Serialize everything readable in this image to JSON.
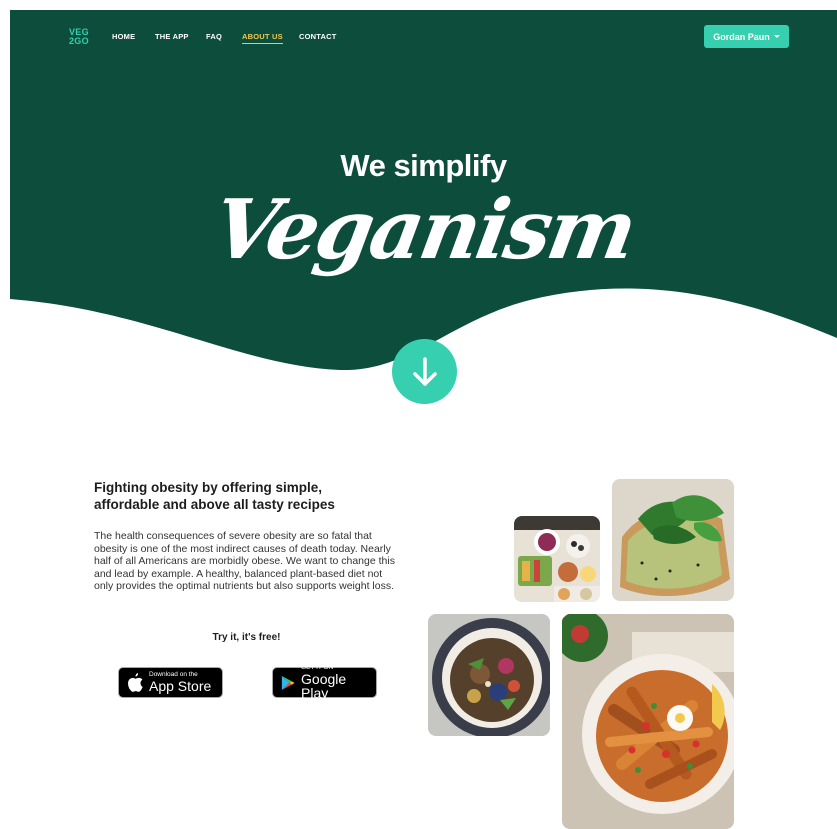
{
  "nav": {
    "logo_line1": "VEG",
    "logo_line2": "2GO",
    "links": [
      {
        "label": "HOME"
      },
      {
        "label": "THE APP"
      },
      {
        "label": "FAQ"
      },
      {
        "label": "ABOUT US"
      },
      {
        "label": "CONTACT"
      }
    ],
    "user_name": "Gordan Paun"
  },
  "hero": {
    "subtitle": "We simplify",
    "title": "Veganism"
  },
  "content": {
    "title": "Fighting obesity by offering simple, affordable and above all tasty recipes",
    "body": "The health consequences of severe obesity are so fatal that obesity is one of the most indirect causes of death today. Nearly half of all Americans are morbidly obese. We want to change this and lead by example. A healthy, balanced plant-based diet not only provides the optimal nutrients but also supports weight loss.",
    "cta": "Try it, it's free!"
  },
  "stores": {
    "apple": {
      "small": "Download on the",
      "big": "App Store"
    },
    "google": {
      "small": "GET IT ON",
      "big": "Google Play"
    }
  },
  "colors": {
    "brand_dark": "#0d4d3c",
    "accent": "#36cfb0",
    "active_link": "#f1c84b"
  },
  "icons": [
    "arrow-down-icon",
    "apple-icon",
    "google-play-icon",
    "caret-down-icon"
  ]
}
